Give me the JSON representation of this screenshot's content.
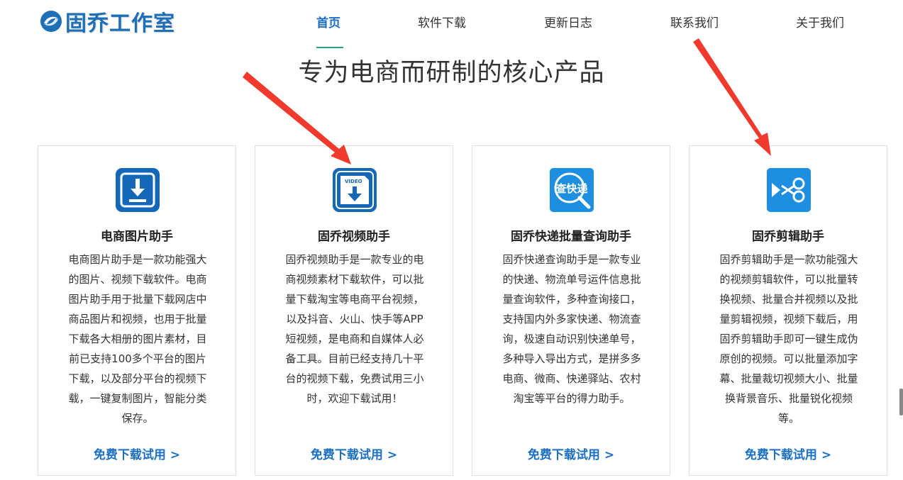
{
  "brand": {
    "name": "固乔工作室",
    "accent": "#1d6fb8",
    "icon": "logo-swirl-icon"
  },
  "nav": {
    "active_color": "#1b6fc2",
    "items": [
      {
        "label": "首页",
        "active": true
      },
      {
        "label": "软件下载",
        "active": false
      },
      {
        "label": "更新日志",
        "active": false
      },
      {
        "label": "联系我们",
        "active": false
      },
      {
        "label": "关于我们",
        "active": false
      }
    ]
  },
  "headline": "专为电商而研制的核心产品",
  "cards": [
    {
      "icon": "download-tray-icon",
      "title": "电商图片助手",
      "description": "电商图片助手是一款功能强大的图片、视频下载软件。电商图片助手用于批量下载网店中商品图片和视频，也用于批量下载各大相册的图片素材，目前已支持100多个平台的图片下载，以及部分平台的视频下载，一键复制图片，智能分类保存。",
      "link": "免费下载试用 >"
    },
    {
      "icon": "video-download-icon",
      "icon_label": "VIDEO",
      "title": "固乔视频助手",
      "description": "固乔视频助手是一款专业的电商视频素材下载软件，可以批量下载淘宝等电商平台视频，以及抖音、火山、快手等APP短视频，是电商和自媒体人必备工具。目前已经支持几十平台的视频下载，免费试用三小时，欢迎下载试用！",
      "link": "免费下载试用 >"
    },
    {
      "icon": "express-search-icon",
      "icon_label": "查快递",
      "title": "固乔快递批量查询助手",
      "description": "固乔快递查询助手是一款专业的快递、物流单号运件信息批量查询软件，多种查询接口，支持国内外多家快递、物流查询，极速自动识别快递单号，多种导入导出方式，是拼多多电商、微商、快递驿站、农村淘宝等平台的得力助手。",
      "link": "免费下载试用 >"
    },
    {
      "icon": "scissors-icon",
      "title": "固乔剪辑助手",
      "description": "固乔剪辑助手是一款功能强大的视频剪辑软件，可以批量转换视频、批量合并视频以及批量剪辑视频，视频下载后，用固乔剪辑助手即可一键生成伪原创的视频。可以批量添加字幕、批量裁切视频大小、批量换背景音乐、批量锐化视频等。",
      "link": "免费下载试用 >"
    }
  ],
  "annotation_arrow_color": "#f03a2e"
}
